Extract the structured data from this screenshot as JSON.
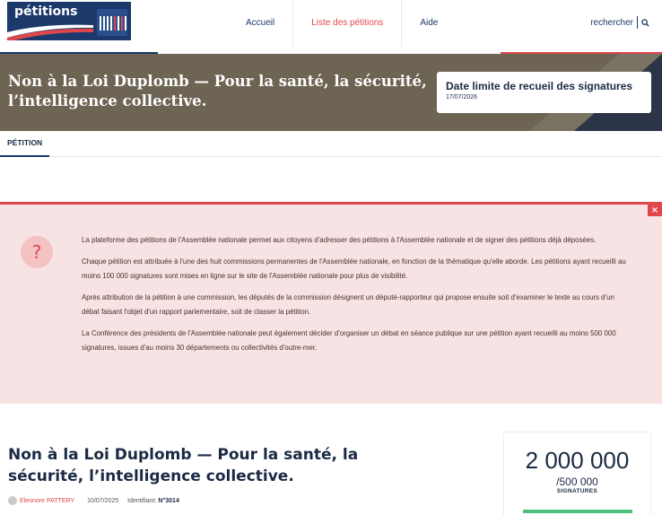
{
  "logo": {
    "text": "pétitions"
  },
  "nav": {
    "items": [
      "Accueil",
      "Liste des pétitions",
      "Aide"
    ],
    "active_index": 1
  },
  "search": {
    "label": "rechercher"
  },
  "banner": {
    "title": "Non à la Loi Duplomb — Pour la santé, la sécurité, l’intelligence collective.",
    "deadline_title": "Date limite de recueil des signatures",
    "deadline_date": "17/07/2026"
  },
  "tabs": [
    {
      "label": "PÉTITION"
    }
  ],
  "info": {
    "close_label": "×",
    "icon": "?",
    "paragraphs": [
      "La plateforme des pétitions de l'Assemblée nationale permet aux citoyens d'adresser des pétitions à l'Assemblée nationale et de signer des pétitions déjà déposées.",
      "Chaque pétition est attribuée à l'une des huit commissions permanentes de l'Assemblée nationale, en fonction de la thématique qu'elle aborde. Les pétitions ayant recueilli au moins 100 000 signatures sont mises en ligne sur le site de l'Assemblée nationale pour plus de visibilité.",
      "Après attribution de la pétition à une commission, les députés de la commission désignent un député-rapporteur qui propose ensuite soit d'examiner le texte au cours d'un débat faisant l'objet d'un rapport parlementaire, soit de classer la pétition.",
      "La Conférence des présidents de l'Assemblée nationale peut également décider d'organiser un débat en séance publique sur une pétition ayant recueilli au moins 500 000 signatures, issues d'au moins 30 départements ou collectivités d'outre-mer."
    ]
  },
  "petition": {
    "title": "Non à la Loi Duplomb — Pour la santé, la sécurité, l’intelligence collective.",
    "author": "Eleonore PATTERY",
    "date": "10/07/2025",
    "id_label": "Identifiant:",
    "id_value": "N°3014"
  },
  "counter": {
    "count": "2 000 000",
    "target": "/500 000",
    "label": "SIGNATURES",
    "progress_fraction": 1.0
  },
  "colors": {
    "navy": "#1b3a6b",
    "red": "#e0474c",
    "banner": "#6d6453",
    "info_bg": "#f7e3e3",
    "progress": "#4cc17a"
  }
}
